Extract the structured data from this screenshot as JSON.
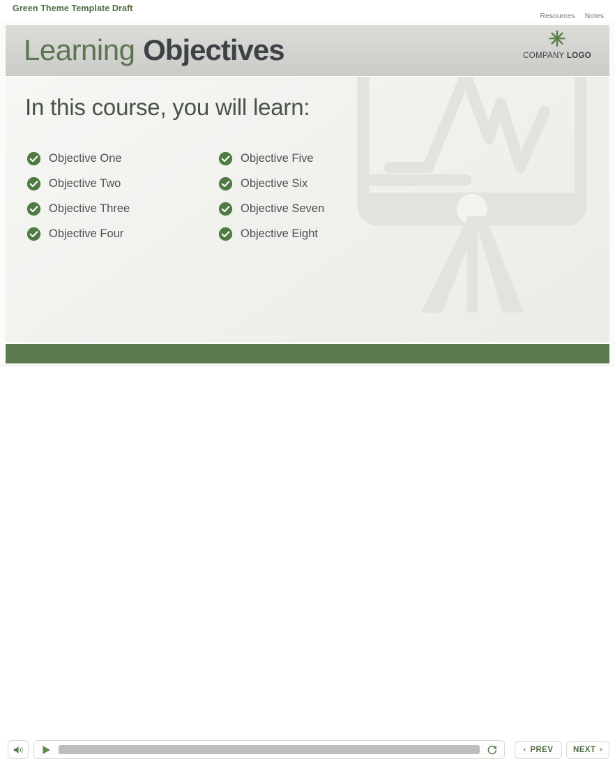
{
  "topbar": {
    "course_title": "Green Theme Template Draft",
    "links": [
      {
        "label": "Resources",
        "name": "resources-link"
      },
      {
        "label": "Notes",
        "name": "notes-link"
      }
    ]
  },
  "slide": {
    "header": {
      "title_light": "Learning",
      "title_bold": "Objectives",
      "logo_mark": "✳",
      "logo_text_regular": "COMPANY ",
      "logo_text_bold": "LOGO"
    },
    "lead_heading": "In this course, you will learn:",
    "objectives_left": [
      "Objective One",
      "Objective Two",
      "Objective Three",
      "Objective Four"
    ],
    "objectives_right": [
      "Objective Five",
      "Objective Six",
      "Objective Seven",
      "Objective Eight"
    ]
  },
  "player": {
    "volume_icon": "speaker-volume-icon",
    "play_icon": "play-icon",
    "replay_icon": "replay-icon",
    "prev_label": "PREV",
    "next_label": "NEXT",
    "prev_chevron": "‹",
    "next_chevron": "›"
  },
  "colors": {
    "brand_green": "#587a4e",
    "title_green": "#4e6b42",
    "accent_green": "#5d8048",
    "dark_gray": "#3d4246",
    "header_band": "#d2d2cf",
    "seek_track": "#bdbdbd"
  }
}
